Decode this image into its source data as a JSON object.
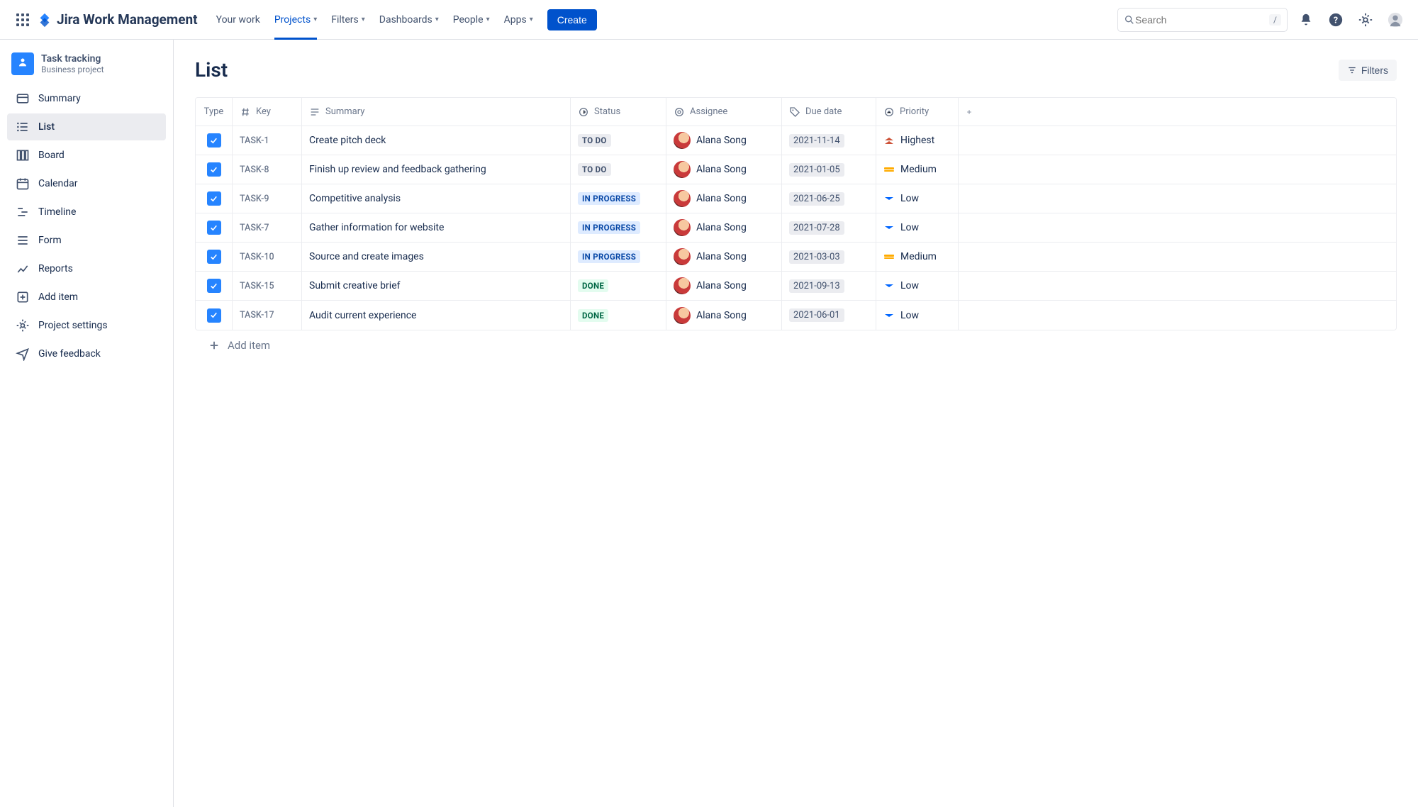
{
  "topnav": {
    "logo_text": "Jira Work Management",
    "items": [
      {
        "label": "Your work",
        "dropdown": false
      },
      {
        "label": "Projects",
        "dropdown": true,
        "active": true
      },
      {
        "label": "Filters",
        "dropdown": true
      },
      {
        "label": "Dashboards",
        "dropdown": true
      },
      {
        "label": "People",
        "dropdown": true
      },
      {
        "label": "Apps",
        "dropdown": true
      }
    ],
    "create_label": "Create",
    "search_placeholder": "Search",
    "search_shortcut": "/"
  },
  "sidebar": {
    "project_name": "Task tracking",
    "project_subtitle": "Business project",
    "items": [
      {
        "icon": "summary-icon",
        "label": "Summary"
      },
      {
        "icon": "list-icon",
        "label": "List",
        "active": true
      },
      {
        "icon": "board-icon",
        "label": "Board"
      },
      {
        "icon": "calendar-icon",
        "label": "Calendar"
      },
      {
        "icon": "timeline-icon",
        "label": "Timeline"
      },
      {
        "icon": "form-icon",
        "label": "Form"
      },
      {
        "icon": "reports-icon",
        "label": "Reports"
      },
      {
        "icon": "add-item-icon",
        "label": "Add item"
      },
      {
        "icon": "settings-icon",
        "label": "Project settings"
      },
      {
        "icon": "feedback-icon",
        "label": "Give feedback"
      }
    ]
  },
  "main": {
    "title": "List",
    "filters_label": "Filters",
    "add_item_label": "Add item",
    "columns": {
      "type": "Type",
      "key": "Key",
      "summary": "Summary",
      "status": "Status",
      "assignee": "Assignee",
      "due": "Due date",
      "priority": "Priority"
    },
    "rows": [
      {
        "key": "TASK-1",
        "summary": "Create pitch deck",
        "status": "TO DO",
        "status_class": "todo",
        "assignee": "Alana Song",
        "due": "2021-11-14",
        "priority": "Highest",
        "priority_class": "highest"
      },
      {
        "key": "TASK-8",
        "summary": "Finish up review and feedback gathering",
        "status": "TO DO",
        "status_class": "todo",
        "assignee": "Alana Song",
        "due": "2021-01-05",
        "priority": "Medium",
        "priority_class": "medium"
      },
      {
        "key": "TASK-9",
        "summary": "Competitive analysis",
        "status": "IN PROGRESS",
        "status_class": "inprogress",
        "assignee": "Alana Song",
        "due": "2021-06-25",
        "priority": "Low",
        "priority_class": "low"
      },
      {
        "key": "TASK-7",
        "summary": "Gather information for website",
        "status": "IN PROGRESS",
        "status_class": "inprogress",
        "assignee": "Alana Song",
        "due": "2021-07-28",
        "priority": "Low",
        "priority_class": "low"
      },
      {
        "key": "TASK-10",
        "summary": "Source and create images",
        "status": "IN PROGRESS",
        "status_class": "inprogress",
        "assignee": "Alana Song",
        "due": "2021-03-03",
        "priority": "Medium",
        "priority_class": "medium"
      },
      {
        "key": "TASK-15",
        "summary": "Submit creative brief",
        "status": "DONE",
        "status_class": "done",
        "assignee": "Alana Song",
        "due": "2021-09-13",
        "priority": "Low",
        "priority_class": "low"
      },
      {
        "key": "TASK-17",
        "summary": "Audit current experience",
        "status": "DONE",
        "status_class": "done",
        "assignee": "Alana Song",
        "due": "2021-06-01",
        "priority": "Low",
        "priority_class": "low"
      }
    ]
  }
}
